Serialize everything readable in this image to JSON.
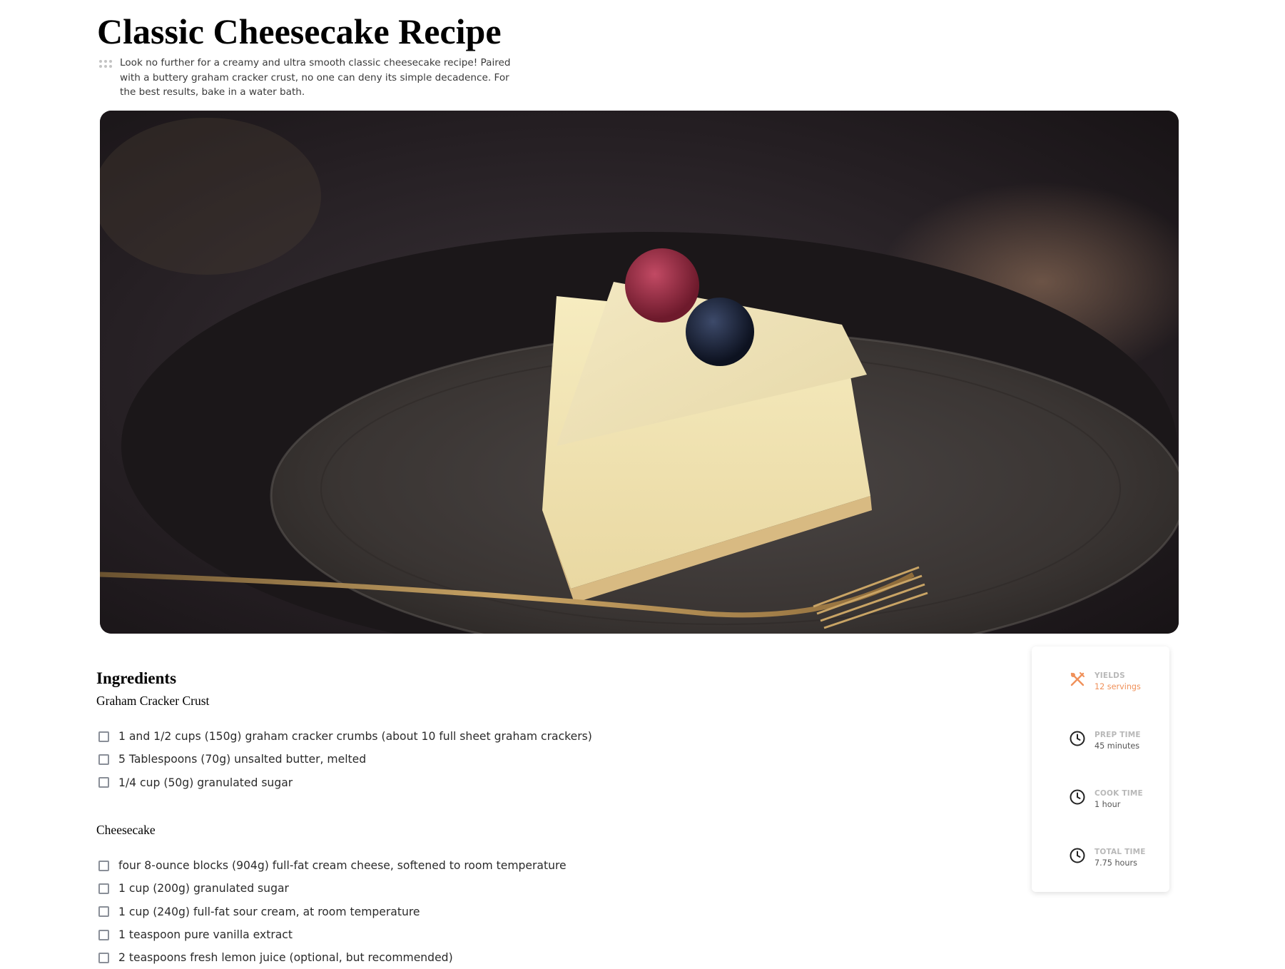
{
  "recipe": {
    "title": "Classic Cheesecake Recipe",
    "description": "Look no further for a creamy and ultra smooth classic cheesecake recipe! Paired with a buttery graham cracker crust, no one can deny its simple decadence. For the best results, bake in a water bath."
  },
  "hero_image": {
    "subject": "slice of cheesecake topped with a raspberry and a blueberry on a dark plate with a gold fork"
  },
  "ingredients": {
    "heading": "Ingredients",
    "groups": [
      {
        "title": "Graham Cracker Crust",
        "items": [
          "1 and 1/2 cups (150g) graham cracker crumbs (about 10 full sheet graham crackers)",
          "5 Tablespoons (70g) unsalted butter, melted",
          "1/4 cup (50g) granulated sugar"
        ]
      },
      {
        "title": "Cheesecake",
        "items": [
          "four 8-ounce blocks (904g) full-fat cream cheese, softened to room temperature",
          "1 cup (200g) granulated sugar",
          "1 cup (240g) full-fat sour cream, at room temperature",
          "1 teaspoon pure vanilla extract",
          "2 teaspoons fresh lemon juice (optional, but recommended)"
        ]
      }
    ]
  },
  "info_card": {
    "accent_color": "#f0915a",
    "items": [
      {
        "icon": "utensils-icon",
        "label": "YIELDS",
        "value": "12 servings"
      },
      {
        "icon": "clock-icon",
        "label": "PREP TIME",
        "value": "45 minutes"
      },
      {
        "icon": "clock-icon",
        "label": "COOK TIME",
        "value": "1 hour"
      },
      {
        "icon": "clock-icon",
        "label": "TOTAL TIME",
        "value": "7.75 hours"
      }
    ]
  }
}
